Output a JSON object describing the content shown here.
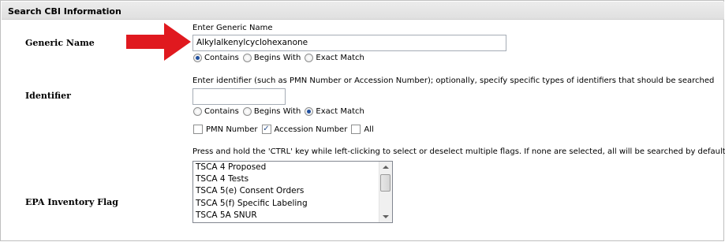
{
  "panel": {
    "title": "Search CBI Information"
  },
  "generic_name": {
    "label": "Generic Name",
    "prompt": "Enter Generic Name",
    "value": "Alkylalkenylcyclohexanone",
    "radios": {
      "contains": "Contains",
      "begins": "Begins With",
      "exact": "Exact Match",
      "selected": "Contains"
    }
  },
  "identifier": {
    "label": "Identifier",
    "prompt": "Enter identifier (such as PMN Number or Accession Number); optionally, specify specific types of identifiers that should be searched",
    "value": "",
    "radios": {
      "contains": "Contains",
      "begins": "Begins With",
      "exact": "Exact Match",
      "selected": "Exact Match"
    },
    "types": {
      "pmn": {
        "label": "PMN Number",
        "checked": false
      },
      "accession": {
        "label": "Accession Number",
        "checked": true
      },
      "all": {
        "label": "All",
        "checked": false
      }
    }
  },
  "epa_flag": {
    "label": "EPA Inventory Flag",
    "prompt": "Press and hold the 'CTRL' key while left-clicking to select or deselect multiple flags. If none are selected, all will be searched by default.",
    "options": [
      "TSCA 4 Proposed",
      "TSCA 4 Tests",
      "TSCA 5(e) Consent Orders",
      "TSCA 5(f) Specific Labeling",
      "TSCA 5A SNUR"
    ]
  },
  "colors": {
    "annotation_arrow": "#e0191f",
    "radio_selected": "#1f4f9e"
  },
  "icons": {
    "pointer": "red-arrow-icon"
  }
}
